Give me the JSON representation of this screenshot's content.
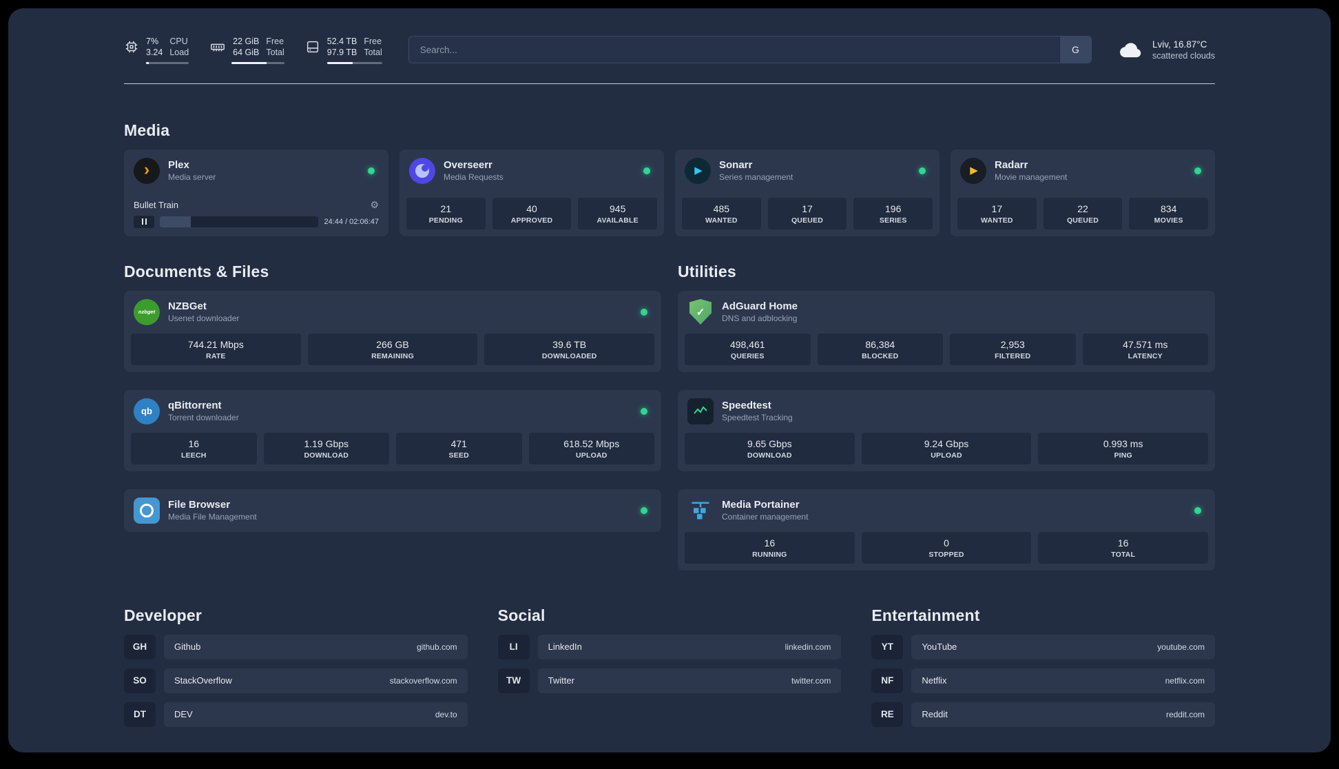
{
  "colors": {
    "status_green": "#2fd693",
    "accent_amber": "#e5a00d"
  },
  "topbar": {
    "cpu": {
      "percent": "7%",
      "load": "3.24",
      "label1": "CPU",
      "label2": "Load",
      "bar_pct": 7
    },
    "memory": {
      "free": "22 GiB",
      "total": "64 GiB",
      "label1": "Free",
      "label2": "Total",
      "bar_pct": 66
    },
    "disk": {
      "free": "52.4 TB",
      "total": "97.9 TB",
      "label1": "Free",
      "label2": "Total",
      "bar_pct": 47
    },
    "search": {
      "placeholder": "Search...",
      "button": "G"
    },
    "weather": {
      "location": "Lviv, 16.87°C",
      "condition": "scattered clouds"
    }
  },
  "sections": {
    "media": {
      "title": "Media",
      "cards": [
        {
          "name": "Plex",
          "subtitle": "Media server",
          "player": {
            "track": "Bullet Train",
            "time": "24:44 / 02:06:47",
            "progress_pct": 19.5
          }
        },
        {
          "name": "Overseerr",
          "subtitle": "Media Requests",
          "stats": [
            {
              "value": "21",
              "label": "PENDING"
            },
            {
              "value": "40",
              "label": "APPROVED"
            },
            {
              "value": "945",
              "label": "AVAILABLE"
            }
          ]
        },
        {
          "name": "Sonarr",
          "subtitle": "Series management",
          "stats": [
            {
              "value": "485",
              "label": "WANTED"
            },
            {
              "value": "17",
              "label": "QUEUED"
            },
            {
              "value": "196",
              "label": "SERIES"
            }
          ]
        },
        {
          "name": "Radarr",
          "subtitle": "Movie management",
          "stats": [
            {
              "value": "17",
              "label": "WANTED"
            },
            {
              "value": "22",
              "label": "QUEUED"
            },
            {
              "value": "834",
              "label": "MOVIES"
            }
          ]
        }
      ]
    },
    "documents": {
      "title": "Documents & Files",
      "cards": [
        {
          "name": "NZBGet",
          "subtitle": "Usenet downloader",
          "stats": [
            {
              "value": "744.21 Mbps",
              "label": "RATE"
            },
            {
              "value": "266 GB",
              "label": "REMAINING"
            },
            {
              "value": "39.6 TB",
              "label": "DOWNLOADED"
            }
          ]
        },
        {
          "name": "qBittorrent",
          "subtitle": "Torrent downloader",
          "stats": [
            {
              "value": "16",
              "label": "LEECH"
            },
            {
              "value": "1.19 Gbps",
              "label": "DOWNLOAD"
            },
            {
              "value": "471",
              "label": "SEED"
            },
            {
              "value": "618.52 Mbps",
              "label": "UPLOAD"
            }
          ]
        },
        {
          "name": "File Browser",
          "subtitle": "Media File Management",
          "stats": []
        }
      ]
    },
    "utilities": {
      "title": "Utilities",
      "cards": [
        {
          "name": "AdGuard Home",
          "subtitle": "DNS and adblocking",
          "stats": [
            {
              "value": "498,461",
              "label": "QUERIES"
            },
            {
              "value": "86,384",
              "label": "BLOCKED"
            },
            {
              "value": "2,953",
              "label": "FILTERED"
            },
            {
              "value": "47.571 ms",
              "label": "LATENCY"
            }
          ]
        },
        {
          "name": "Speedtest",
          "subtitle": "Speedtest Tracking",
          "stats": [
            {
              "value": "9.65 Gbps",
              "label": "DOWNLOAD"
            },
            {
              "value": "9.24 Gbps",
              "label": "UPLOAD"
            },
            {
              "value": "0.993 ms",
              "label": "PING"
            }
          ]
        },
        {
          "name": "Media Portainer",
          "subtitle": "Container management",
          "stats": [
            {
              "value": "16",
              "label": "RUNNING"
            },
            {
              "value": "0",
              "label": "STOPPED"
            },
            {
              "value": "16",
              "label": "TOTAL"
            }
          ]
        }
      ]
    }
  },
  "bookmarks": [
    {
      "title": "Developer",
      "items": [
        {
          "abbr": "GH",
          "name": "Github",
          "domain": "github.com"
        },
        {
          "abbr": "SO",
          "name": "StackOverflow",
          "domain": "stackoverflow.com"
        },
        {
          "abbr": "DT",
          "name": "DEV",
          "domain": "dev.to"
        }
      ]
    },
    {
      "title": "Social",
      "items": [
        {
          "abbr": "LI",
          "name": "LinkedIn",
          "domain": "linkedin.com"
        },
        {
          "abbr": "TW",
          "name": "Twitter",
          "domain": "twitter.com"
        }
      ]
    },
    {
      "title": "Entertainment",
      "items": [
        {
          "abbr": "YT",
          "name": "YouTube",
          "domain": "youtube.com"
        },
        {
          "abbr": "NF",
          "name": "Netflix",
          "domain": "netflix.com"
        },
        {
          "abbr": "RE",
          "name": "Reddit",
          "domain": "reddit.com"
        }
      ]
    }
  ]
}
